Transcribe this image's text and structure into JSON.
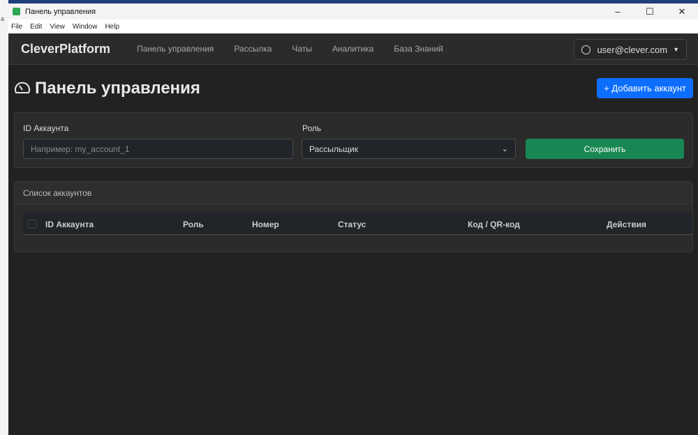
{
  "window": {
    "title": "Панель управления",
    "menu": [
      "File",
      "Edit",
      "View",
      "Window",
      "Help"
    ]
  },
  "navbar": {
    "brand": "CleverPlatform",
    "links": [
      "Панель управления",
      "Рассылка",
      "Чаты",
      "Аналитика",
      "База Знаний"
    ],
    "user": "user@clever.com"
  },
  "page": {
    "title": "Панель управления",
    "add_button": "+ Добавить аккаунт"
  },
  "form": {
    "id_label": "ID Аккаунта",
    "id_placeholder": "Например: my_account_1",
    "role_label": "Роль",
    "role_value": "Рассыльщик",
    "save": "Сохранить"
  },
  "accounts": {
    "title": "Список аккаунтов",
    "columns": [
      "ID Аккаунта",
      "Роль",
      "Номер",
      "Статус",
      "Код / QR-код",
      "Действия"
    ]
  },
  "colors": {
    "primary": "#0d6efd",
    "success": "#198754"
  }
}
